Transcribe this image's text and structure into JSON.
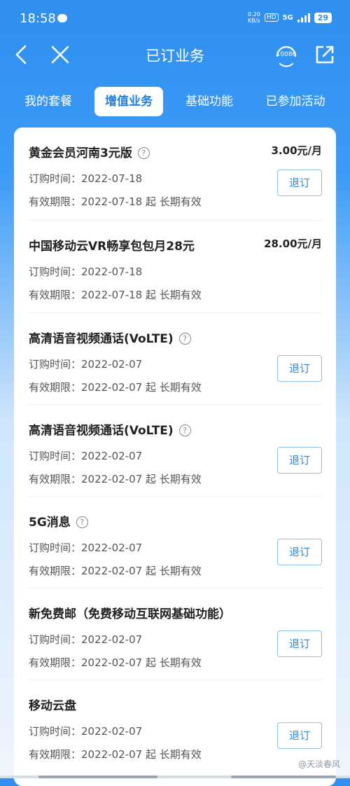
{
  "status_bar": {
    "time": "18:58",
    "net_speed_value": "0.20",
    "net_speed_unit": "KB/s",
    "hd": "HD",
    "network": "5G",
    "battery": "29"
  },
  "nav": {
    "title": "已订业务",
    "service_number": "10086"
  },
  "tabs": [
    {
      "label": "我的套餐"
    },
    {
      "label": "增值业务",
      "active": true
    },
    {
      "label": "基础功能"
    },
    {
      "label": "已参加活动"
    }
  ],
  "services": [
    {
      "name": "黄金会员河南3元版",
      "price": "3.00元/月",
      "order_line": "订购时间：2022-07-18",
      "valid_line": "有效期限：2022-07-18 起 长期有效",
      "button": "退订"
    },
    {
      "name": "中国移动云VR畅享包包月28元",
      "price": "28.00元/月",
      "order_line": "订购时间：2022-07-18",
      "valid_line": "有效期限：2022-07-18 起 长期有效"
    },
    {
      "name": "高清语音视频通话(VoLTE)",
      "order_line": "订购时间：2022-02-07",
      "valid_line": "有效期限：2022-02-07 起 长期有效",
      "button": "退订"
    },
    {
      "name": "高清语音视频通话(VoLTE)",
      "order_line": "订购时间：2022-02-07",
      "valid_line": "有效期限：2022-02-07 起 长期有效",
      "button": "退订"
    },
    {
      "name": "5G消息",
      "order_line": "订购时间：2022-02-07",
      "valid_line": "有效期限：2022-02-07 起 长期有效",
      "button": "退订"
    },
    {
      "name": "新免费邮（免费移动互联网基础功能）",
      "order_line": "订购时间：2022-02-07",
      "valid_line": "有效期限：2022-02-07 起 长期有效",
      "button": "退订"
    },
    {
      "name": "移动云盘",
      "order_line": "订购时间：2022-02-07",
      "valid_line": "有效期限：2022-02-07 起 长期有效",
      "button": "退订"
    }
  ],
  "help_symbol": "?",
  "watermark": "@天淡春风"
}
